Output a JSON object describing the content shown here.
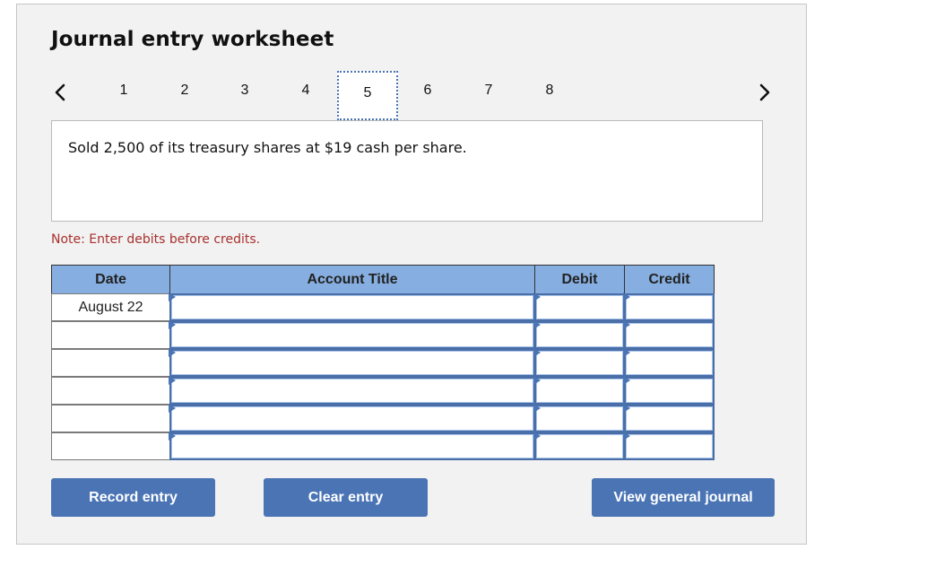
{
  "worksheet": {
    "title": "Journal entry worksheet",
    "pager": {
      "prev_icon": "chevron-left-icon",
      "next_icon": "chevron-right-icon",
      "pages": [
        "1",
        "2",
        "3",
        "4",
        "5",
        "6",
        "7",
        "8"
      ],
      "current_page": "5"
    },
    "description": "Sold 2,500 of its treasury shares at $19 cash per share.",
    "note": "Note: Enter debits before credits.",
    "table": {
      "columns": [
        "Date",
        "Account Title",
        "Debit",
        "Credit"
      ],
      "rows": [
        {
          "date": "August 22",
          "account": "",
          "debit": "",
          "credit": ""
        },
        {
          "date": "",
          "account": "",
          "debit": "",
          "credit": ""
        },
        {
          "date": "",
          "account": "",
          "debit": "",
          "credit": ""
        },
        {
          "date": "",
          "account": "",
          "debit": "",
          "credit": ""
        },
        {
          "date": "",
          "account": "",
          "debit": "",
          "credit": ""
        },
        {
          "date": "",
          "account": "",
          "debit": "",
          "credit": ""
        }
      ]
    },
    "buttons": {
      "record": "Record entry",
      "clear": "Clear entry",
      "view_journal": "View general journal"
    },
    "colors": {
      "accent": "#4a74b4",
      "header_bg": "#86aee0",
      "note_text": "#a8312e",
      "panel_bg": "#f2f2f2"
    }
  }
}
